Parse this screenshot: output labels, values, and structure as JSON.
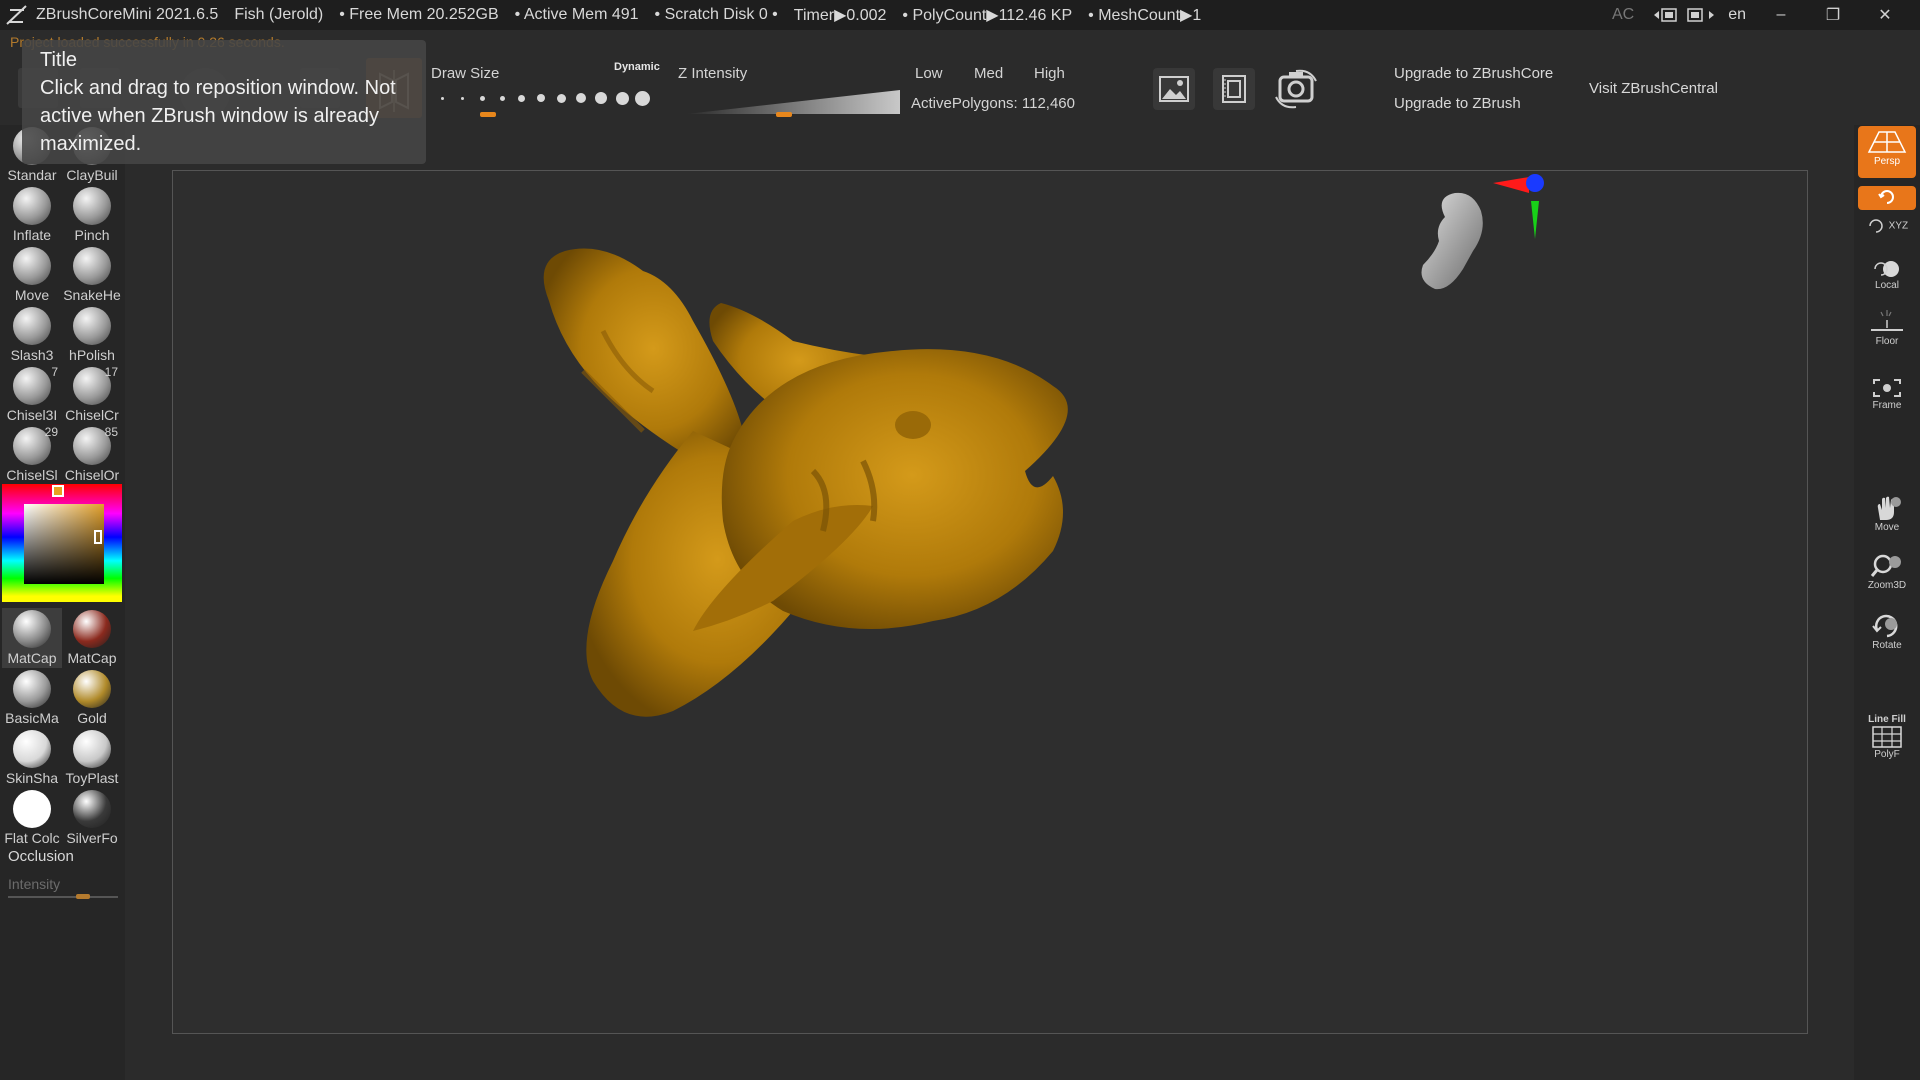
{
  "titlebar": {
    "app": "ZBrushCoreMini 2021.6.5",
    "document": "Fish (Jerold)",
    "free_mem": "• Free Mem 20.252GB",
    "active_mem": "• Active Mem 491",
    "scratch": "• Scratch Disk 0 •",
    "timer": "Timer▶0.002",
    "polycount": "• PolyCount▶112.46 KP",
    "meshcount": "• MeshCount▶1",
    "ac": "AC",
    "lang": "en",
    "minimize": "–",
    "restore": "❐",
    "close": "✕"
  },
  "status_message": "Project loaded successfully in 0.26 seconds.",
  "tooltip": {
    "title": "Title",
    "body": "Click and drag to reposition window. Not active when ZBrush window is already maximized."
  },
  "shelf": {
    "draw_size_label": "Draw Size",
    "dynamic_label": "Dynamic",
    "draw_size_level": 0.25,
    "z_intensity_label": "Z Intensity",
    "z_intensity_level": 0.5,
    "low": "Low",
    "med": "Med",
    "high": "High",
    "active_polygons": "ActivePolygons: 112,460",
    "upgrade_core": "Upgrade to ZBrushCore",
    "upgrade_zbrush": "Upgrade to ZBrush",
    "visit_central": "Visit ZBrushCentral"
  },
  "brushes": [
    {
      "label": "Standar",
      "badge": ""
    },
    {
      "label": "ClayBuil",
      "badge": ""
    },
    {
      "label": "Inflate",
      "badge": ""
    },
    {
      "label": "Pinch",
      "badge": ""
    },
    {
      "label": "Move",
      "badge": ""
    },
    {
      "label": "SnakeHe",
      "badge": ""
    },
    {
      "label": "Slash3",
      "badge": ""
    },
    {
      "label": "hPolish",
      "badge": ""
    },
    {
      "label": "Chisel3I",
      "badge": "7"
    },
    {
      "label": "ChiselCr",
      "badge": "17"
    },
    {
      "label": "ChiselSl",
      "badge": "29"
    },
    {
      "label": "ChiselOr",
      "badge": "85"
    }
  ],
  "materials": [
    {
      "label": "MatCap",
      "color": "#8a8a8a"
    },
    {
      "label": "MatCap",
      "color": "#8b2a1e"
    },
    {
      "label": "BasicMa",
      "color": "#9a9a9a"
    },
    {
      "label": "Gold",
      "color": "#b08a2a"
    },
    {
      "label": "SkinSha",
      "color": "#d8d8d8"
    },
    {
      "label": "ToyPlast",
      "color": "#c8c8c8"
    },
    {
      "label": "Flat Colc",
      "color": "#ffffff"
    },
    {
      "label": "SilverFo",
      "color": "#3a3a3a"
    }
  ],
  "left_bottom": {
    "occlusion": "Occlusion",
    "intensity": "Intensity"
  },
  "right_tray": {
    "persp": "Persp",
    "xyz": "XYZ",
    "local": "Local",
    "floor": "Floor",
    "frame": "Frame",
    "move": "Move",
    "zoom3d": "Zoom3D",
    "rotate": "Rotate",
    "linefill": "Line Fill",
    "polyf": "PolyF"
  },
  "colors": {
    "accent": "#e8761a",
    "model": "#b8820c",
    "background": "#2b2b2b"
  }
}
